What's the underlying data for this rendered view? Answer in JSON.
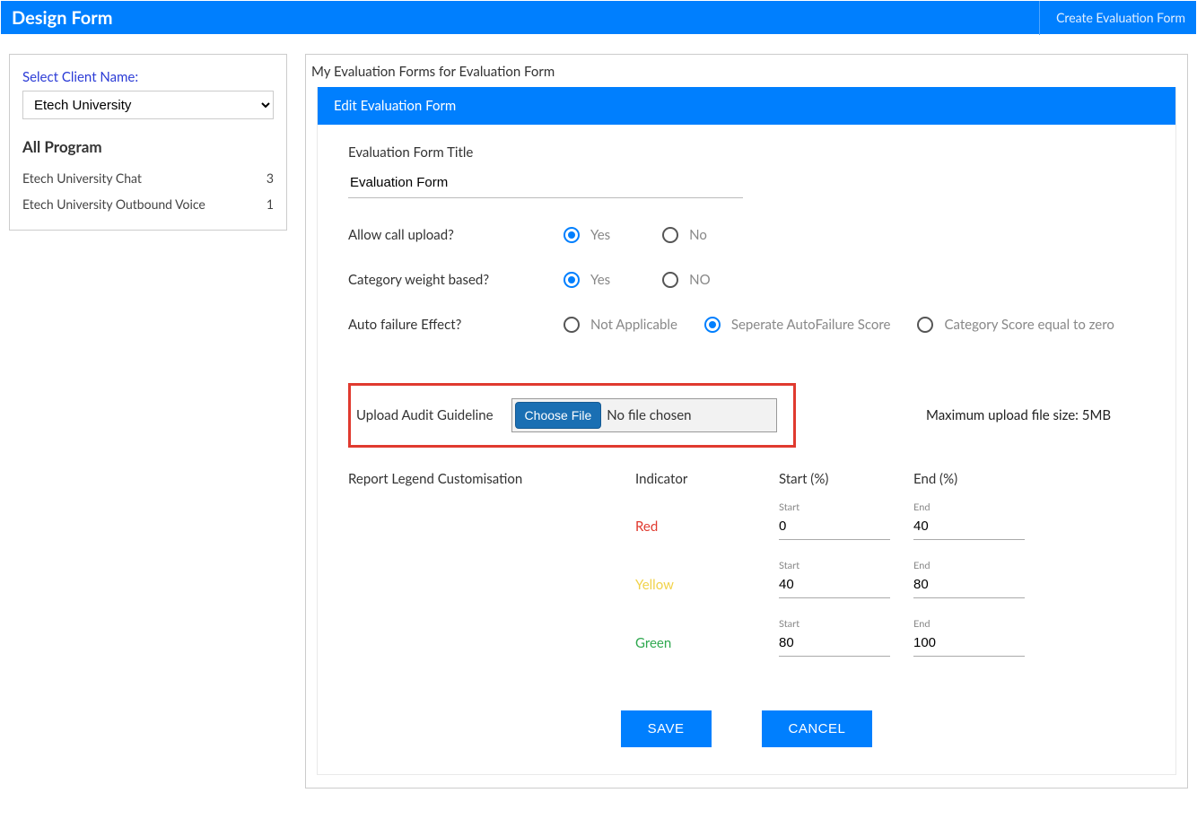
{
  "topbar": {
    "title": "Design Form",
    "create_link": "Create Evaluation Form"
  },
  "sidebar": {
    "select_label": "Select Client Name:",
    "selected_client": "Etech University",
    "all_program_label": "All Program",
    "programs": [
      {
        "name": "Etech University Chat",
        "count": "3"
      },
      {
        "name": "Etech University Outbound Voice",
        "count": "1"
      }
    ]
  },
  "main": {
    "list_title": "My Evaluation Forms for Evaluation Form",
    "form_header": "Edit Evaluation Form",
    "title_label": "Evaluation Form Title",
    "title_value": "Evaluation Form",
    "questions": {
      "allow_upload": {
        "label": "Allow call upload?",
        "yes": "Yes",
        "no": "No",
        "value": "yes"
      },
      "weight_based": {
        "label": "Category weight based?",
        "yes": "Yes",
        "no": "NO",
        "value": "yes"
      },
      "auto_failure": {
        "label": "Auto failure Effect?",
        "options": {
          "na": "Not Applicable",
          "sep": "Seperate AutoFailure Score",
          "zero": "Category Score equal to zero"
        },
        "value": "sep"
      }
    },
    "upload": {
      "label": "Upload Audit Guideline",
      "choose": "Choose File",
      "status": "No file chosen",
      "max_size": "Maximum upload file size: 5MB"
    },
    "legend": {
      "title": "Report Legend Customisation",
      "indicator_label": "Indicator",
      "start_label": "Start (%)",
      "end_label": "End (%)",
      "start_ph": "Start",
      "end_ph": "End",
      "rows": [
        {
          "name": "Red",
          "class": "red",
          "start": "0",
          "end": "40"
        },
        {
          "name": "Yellow",
          "class": "yellow",
          "start": "40",
          "end": "80"
        },
        {
          "name": "Green",
          "class": "green",
          "start": "80",
          "end": "100"
        }
      ]
    },
    "buttons": {
      "save": "SAVE",
      "cancel": "CANCEL"
    }
  }
}
